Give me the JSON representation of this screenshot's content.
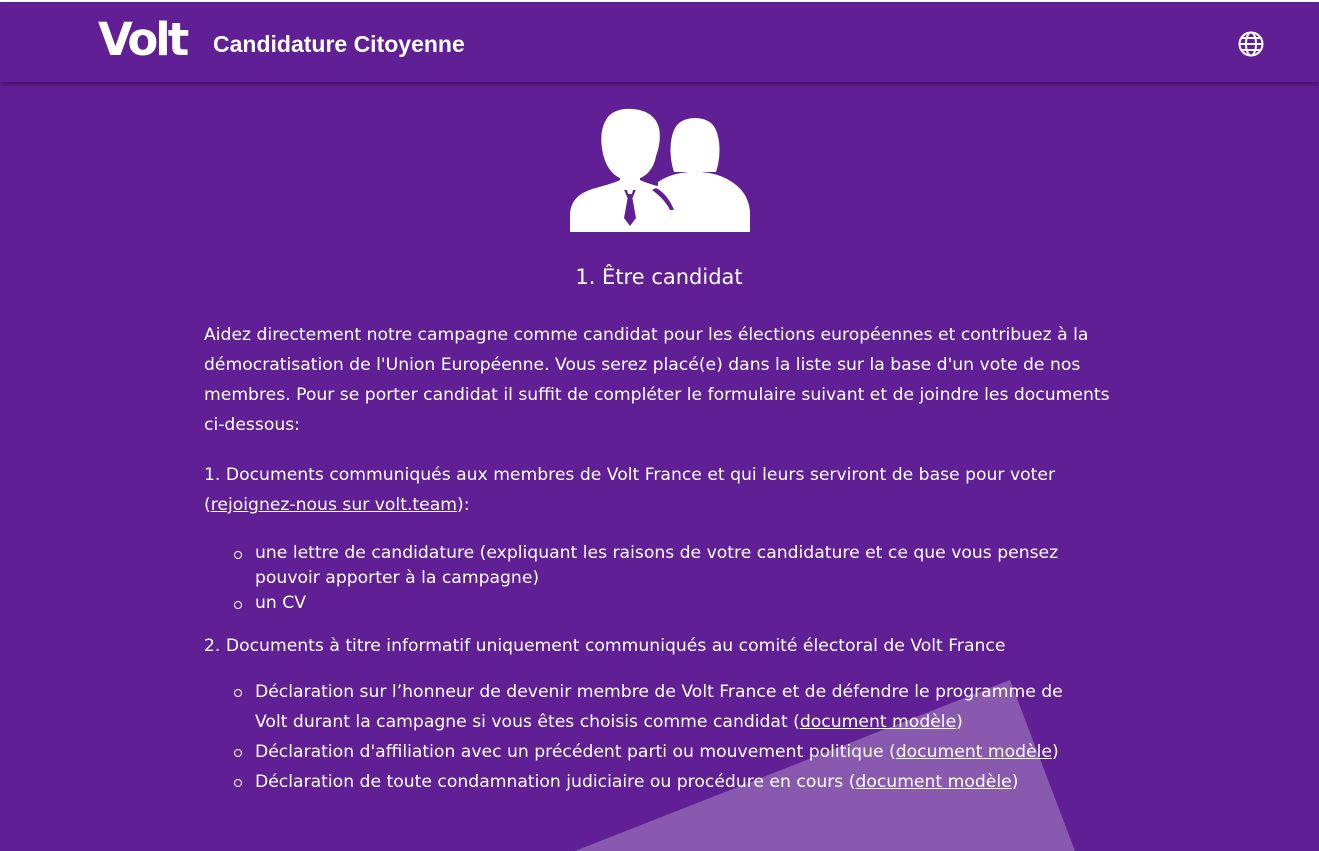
{
  "header": {
    "logo_text": "Volt",
    "title": "Candidature Citoyenne",
    "language_icon": "globe-icon"
  },
  "main": {
    "illustration_icon": "people-icon",
    "heading": "1. Être candidat",
    "intro": "Aidez directement notre campagne comme candidat pour les élections européennes et contribuez à la démocratisation de l'Union Européenne. Vous serez placé(e) dans la liste sur la base d'un vote de nos membres. Pour se porter candidat il suffit de compléter le formulaire suivant et de joindre les documents ci-dessous:",
    "section1": {
      "text_before": "1. Documents communiqués aux membres de Volt France et qui leurs serviront de base pour voter (",
      "link": "rejoignez-nous sur volt.team",
      "text_after": "):",
      "items": [
        "une lettre de candidature (expliquant les raisons de votre candidature et ce que vous pensez pouvoir apporter à la campagne)",
        "un CV"
      ]
    },
    "section2": {
      "text": "2. Documents à titre informatif uniquement communiqués au comité électoral de Volt France",
      "items": [
        {
          "text": "Déclaration sur l’honneur de devenir membre de Volt France et de défendre le programme de Volt durant la campagne si vous êtes choisis comme candidat (",
          "link": "document modèle",
          "suffix": ")"
        },
        {
          "text": "Déclaration d'affiliation avec un précédent parti ou mouvement politique (",
          "link": "document modèle",
          "suffix": ")"
        },
        {
          "text": "Déclaration de toute condamnation judiciaire ou procédure en cours (",
          "link": "document modèle",
          "suffix": ")"
        }
      ]
    }
  },
  "colors": {
    "brand_purple": "#611f95",
    "text": "#ffffff",
    "beam": "#9a6fc4"
  }
}
